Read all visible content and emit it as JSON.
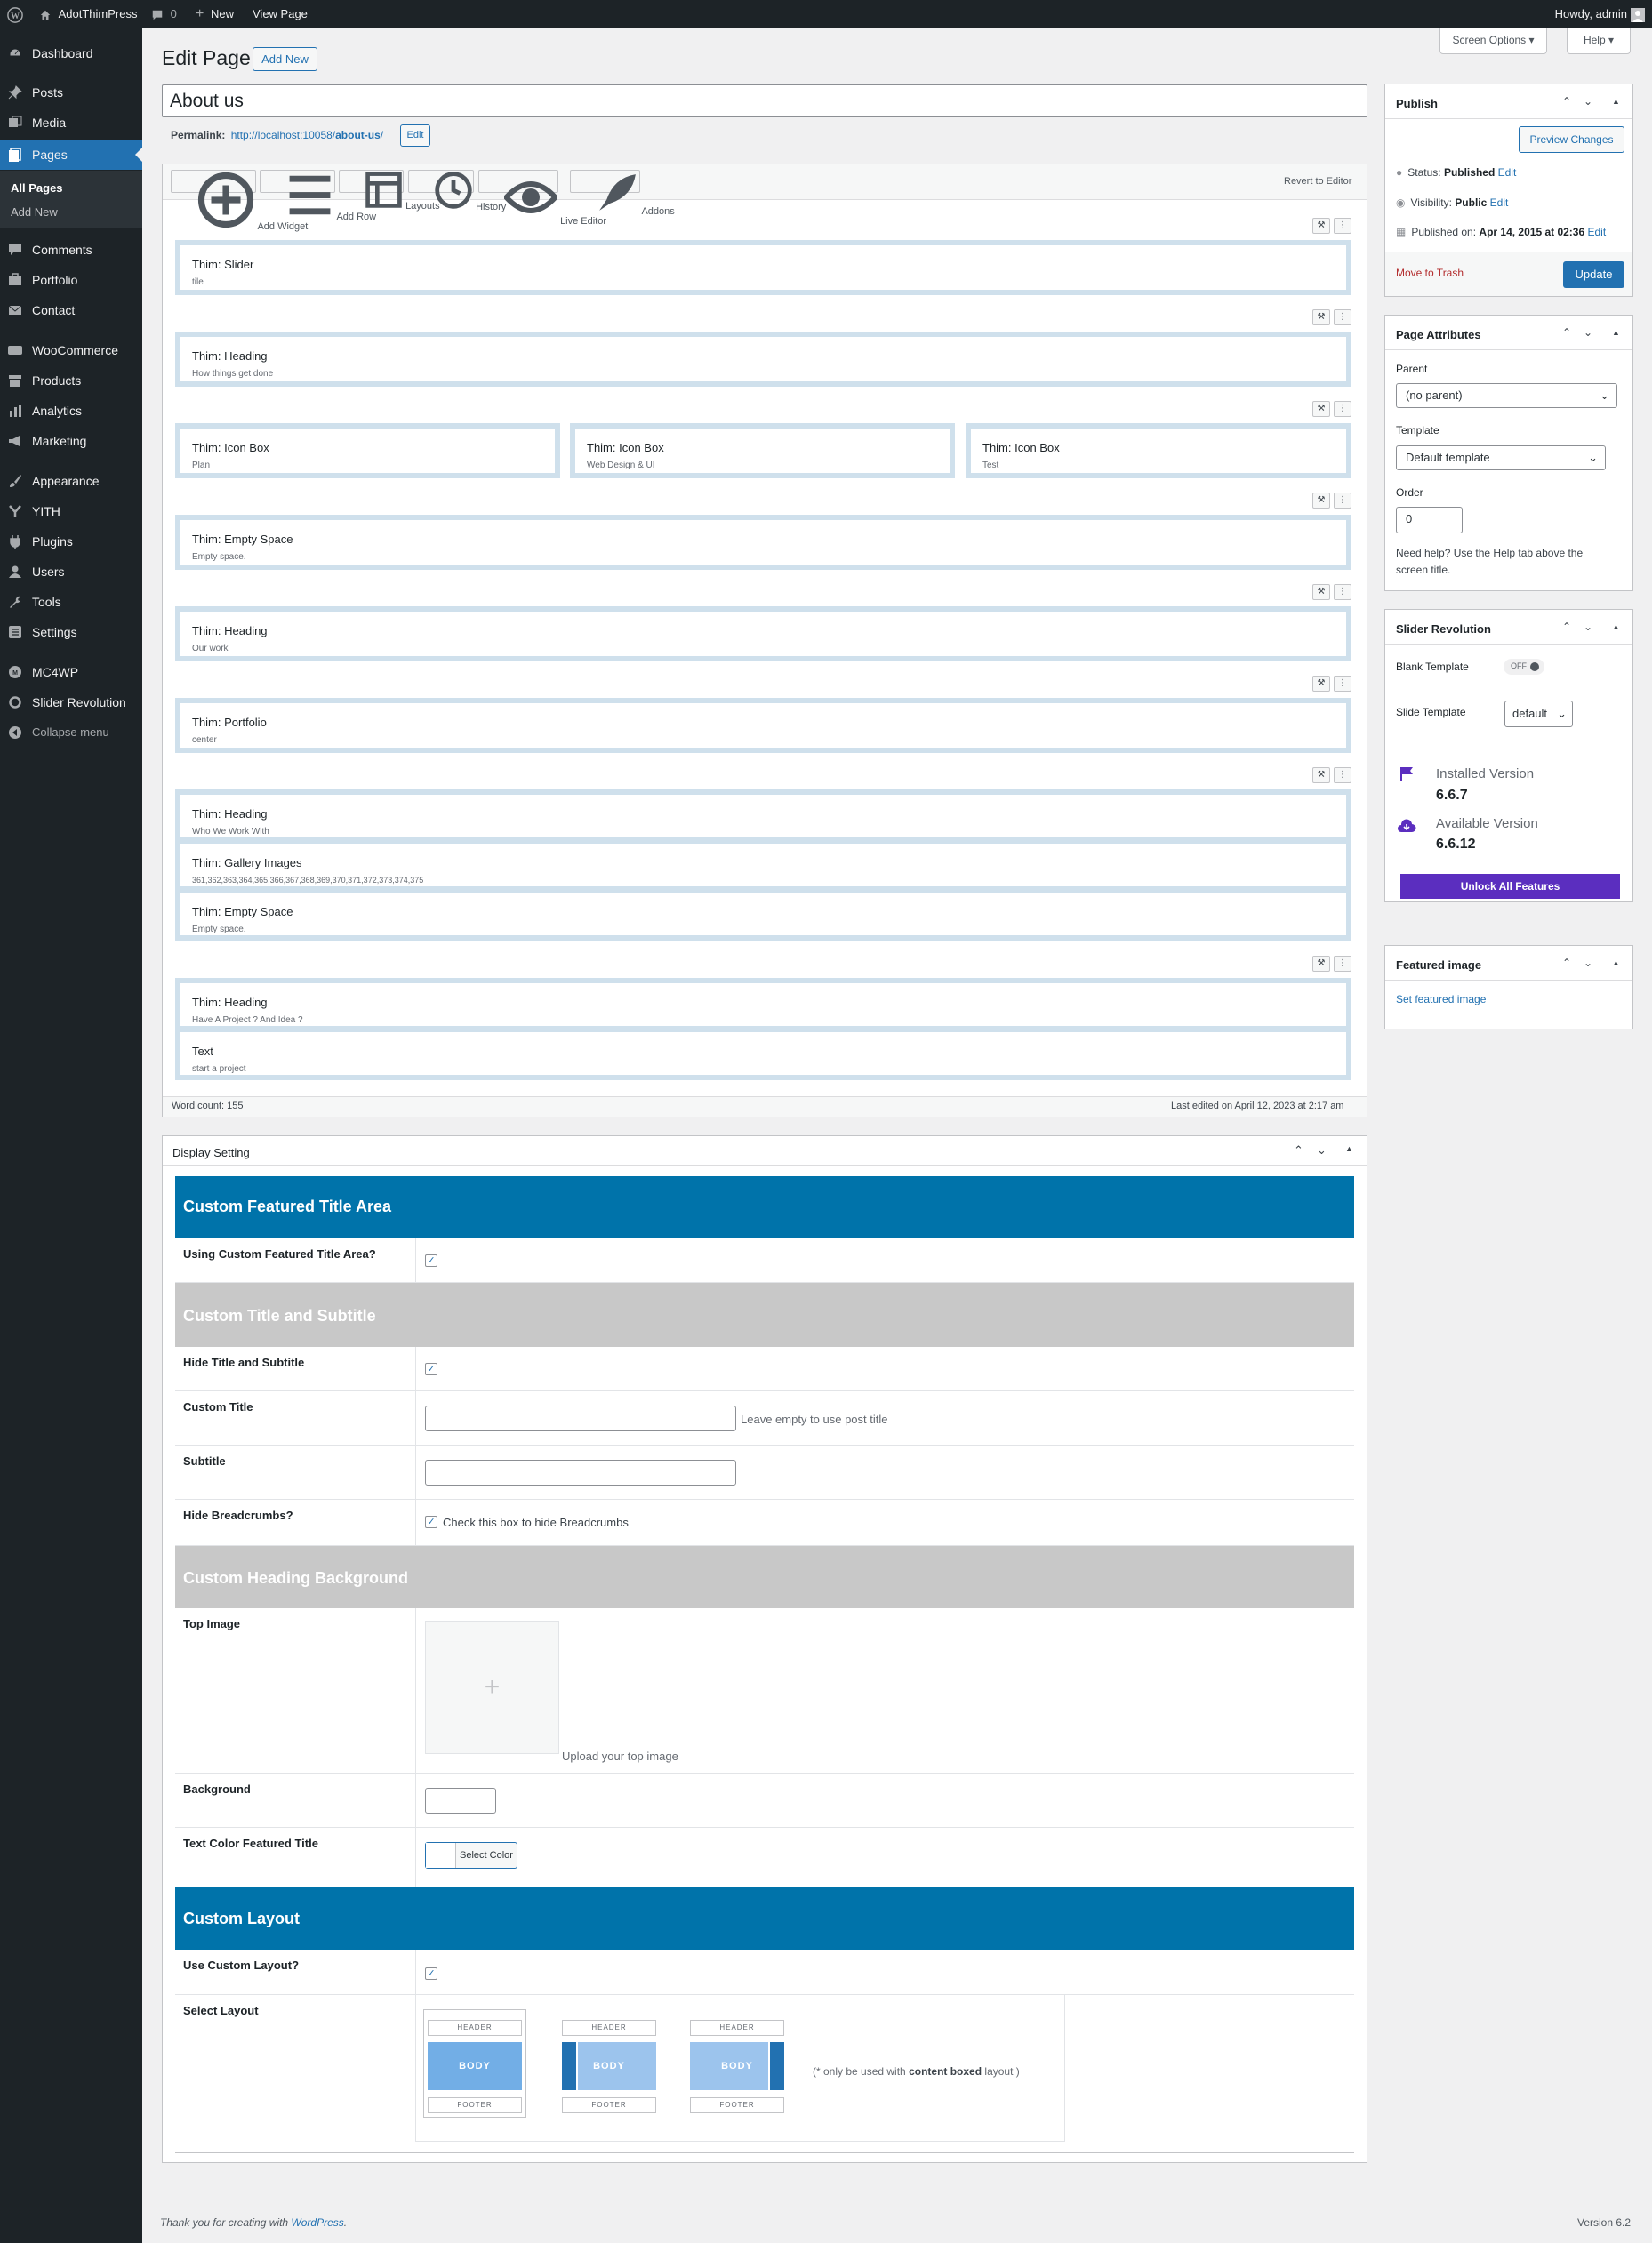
{
  "admin_bar": {
    "site_name": "AdotThimPress",
    "comments_count": "0",
    "new_label": "New",
    "view_page": "View Page",
    "howdy": "Howdy, admin"
  },
  "sidebar": {
    "dashboard": "Dashboard",
    "posts": "Posts",
    "media": "Media",
    "pages": "Pages",
    "all_pages": "All Pages",
    "add_new": "Add New",
    "comments": "Comments",
    "portfolio": "Portfolio",
    "contact": "Contact",
    "woocommerce": "WooCommerce",
    "products": "Products",
    "analytics": "Analytics",
    "marketing": "Marketing",
    "appearance": "Appearance",
    "yith": "YITH",
    "plugins": "Plugins",
    "users": "Users",
    "tools": "Tools",
    "settings": "Settings",
    "mc4wp": "MC4WP",
    "slider_revolution": "Slider Revolution",
    "collapse": "Collapse menu"
  },
  "header": {
    "title": "Edit Page",
    "add_new": "Add New",
    "screen_options": "Screen Options ▾",
    "help": "Help ▾"
  },
  "editor": {
    "post_title": "About us",
    "permalink_label": "Permalink:",
    "permalink_base": "http://localhost:10058/",
    "permalink_slug": "about-us",
    "permalink_trail": "/",
    "edit": "Edit",
    "toolbar": {
      "add_widget": "Add Widget",
      "add_row": "Add Row",
      "layouts": "Layouts",
      "history": "History",
      "live_editor": "Live Editor",
      "addons": "Addons",
      "revert": "Revert to Editor"
    },
    "widgets": {
      "w1": {
        "title": "Thim: Slider",
        "desc": "tile"
      },
      "w2": {
        "title": "Thim: Heading",
        "desc": "How things get done"
      },
      "w3a": {
        "title": "Thim: Icon Box",
        "desc": "Plan"
      },
      "w3b": {
        "title": "Thim: Icon Box",
        "desc": "Web Design & UI"
      },
      "w3c": {
        "title": "Thim: Icon Box",
        "desc": "Test"
      },
      "w4": {
        "title": "Thim: Empty Space",
        "desc": "Empty space."
      },
      "w5": {
        "title": "Thim: Heading",
        "desc": "Our work"
      },
      "w6": {
        "title": "Thim: Portfolio",
        "desc": "center"
      },
      "w7a": {
        "title": "Thim: Heading",
        "desc": "Who We Work With"
      },
      "w7b": {
        "title": "Thim: Gallery Images",
        "desc": "361,362,363,364,365,366,367,368,369,370,371,372,373,374,375"
      },
      "w7c": {
        "title": "Thim: Empty Space",
        "desc": "Empty space."
      },
      "w8a": {
        "title": "Thim: Heading",
        "desc": "Have A Project ? And Idea ?"
      },
      "w8b": {
        "title": "Text",
        "desc": "start a project"
      }
    },
    "word_count": "Word count: 155",
    "last_edited": "Last edited on April 12, 2023 at 2:17 am"
  },
  "display_setting": {
    "title": "Display Setting",
    "sec_featured": "Custom Featured Title Area",
    "using_custom": "Using Custom Featured Title Area?",
    "sec_title_sub": "Custom Title and Subtitle",
    "hide_title": "Hide Title and Subtitle",
    "custom_title": "Custom Title",
    "custom_title_hint": "Leave empty to use post title",
    "subtitle": "Subtitle",
    "hide_breadcrumbs": "Hide Breadcrumbs?",
    "hide_breadcrumbs_hint": "Check this box to hide Breadcrumbs",
    "sec_heading_bg": "Custom Heading Background",
    "top_image": "Top Image",
    "upload_hint": "Upload your top image",
    "background": "Background",
    "text_color": "Text Color Featured Title",
    "select_color": "Select Color",
    "sec_layout": "Custom Layout",
    "use_custom_layout": "Use Custom Layout?",
    "select_layout": "Select Layout",
    "layout_header": "HEADER",
    "layout_body": "BODY",
    "layout_footer": "FOOTER",
    "layout_note_pre": "(* only be used with ",
    "layout_note_bold": "content boxed",
    "layout_note_post": " layout )"
  },
  "publish": {
    "title": "Publish",
    "preview": "Preview Changes",
    "status_label": "Status: ",
    "status_value": "Published",
    "visibility_label": "Visibility: ",
    "visibility_value": "Public",
    "published_on_label": "Published on: ",
    "published_on_value": "Apr 14, 2015 at 02:36",
    "edit": "Edit",
    "trash": "Move to Trash",
    "update": "Update"
  },
  "page_attributes": {
    "title": "Page Attributes",
    "parent_label": "Parent",
    "parent_value": "(no parent)",
    "template_label": "Template",
    "template_value": "Default template",
    "order_label": "Order",
    "order_value": "0",
    "help_text_1": "Need help? Use the Help tab above the",
    "help_text_2": "screen title."
  },
  "slider_revolution": {
    "title": "Slider Revolution",
    "blank_template": "Blank Template",
    "toggle_off": "OFF",
    "slide_template": "Slide Template",
    "slide_template_value": "default",
    "installed_label": "Installed Version",
    "installed_value": "6.6.7",
    "available_label": "Available Version",
    "available_value": "6.6.12",
    "unlock": "Unlock All Features"
  },
  "featured_image": {
    "title": "Featured image",
    "set": "Set featured image"
  },
  "footer": {
    "thanks_pre": "Thank you for creating with ",
    "thanks_link": "WordPress",
    "thanks_post": ".",
    "version": "Version 6.2"
  },
  "colors": {
    "accent": "#2271b1",
    "blue_band": "#0073aa",
    "grey_band": "#c8c8c8",
    "purple": "#5b2ebf",
    "sidebar": "#1d2327"
  }
}
